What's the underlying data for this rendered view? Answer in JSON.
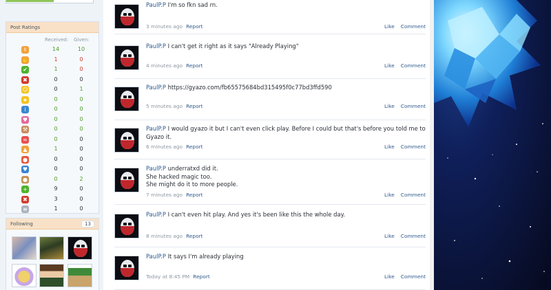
{
  "ratings": {
    "title": "Post Ratings",
    "received_label": "Received:",
    "given_label": "Given:",
    "rows": [
      {
        "icon": "thumbs-up-icon",
        "color": "#f2a13b",
        "glyph": "✌",
        "received": "14",
        "given": "10",
        "rec_tone": "pos",
        "giv_tone": "pos"
      },
      {
        "icon": "thumbs-down-icon",
        "color": "#f2a13b",
        "glyph": "✋",
        "received": "1",
        "given": "0",
        "rec_tone": "neg",
        "giv_tone": "neg"
      },
      {
        "icon": "agree-icon",
        "color": "#4fb32d",
        "glyph": "✔",
        "received": "1",
        "given": "0",
        "rec_tone": "pos",
        "giv_tone": "neg"
      },
      {
        "icon": "disagree-icon",
        "color": "#d33a2d",
        "glyph": "✖",
        "received": "0",
        "given": "0",
        "rec_tone": "",
        "giv_tone": ""
      },
      {
        "icon": "funny-icon",
        "color": "#f5c21b",
        "glyph": "☺",
        "received": "0",
        "given": "1",
        "rec_tone": "",
        "giv_tone": "pos"
      },
      {
        "icon": "winner-icon",
        "color": "#f5c21b",
        "glyph": "★",
        "received": "0",
        "given": "0",
        "rec_tone": "pos",
        "giv_tone": "pos"
      },
      {
        "icon": "informative-icon",
        "color": "#3a86d1",
        "glyph": "i",
        "received": "0",
        "given": "0",
        "rec_tone": "pos",
        "giv_tone": "pos"
      },
      {
        "icon": "friendly-icon",
        "color": "#e36b9b",
        "glyph": "♥",
        "received": "0",
        "given": "0",
        "rec_tone": "pos",
        "giv_tone": "pos"
      },
      {
        "icon": "useful-icon",
        "color": "#c98b5e",
        "glyph": "⚒",
        "received": "0",
        "given": "0",
        "rec_tone": "pos",
        "giv_tone": "pos"
      },
      {
        "icon": "creative-icon",
        "color": "#e94f4f",
        "glyph": "≈",
        "received": "0",
        "given": "0",
        "rec_tone": "pos",
        "giv_tone": ""
      },
      {
        "icon": "optimistic-icon",
        "color": "#f2a13b",
        "glyph": "▲",
        "received": "1",
        "given": "0",
        "rec_tone": "pos",
        "giv_tone": ""
      },
      {
        "icon": "late-icon",
        "color": "#e9563f",
        "glyph": "●",
        "received": "0",
        "given": "0",
        "rec_tone": "",
        "giv_tone": ""
      },
      {
        "icon": "artistic-icon",
        "color": "#3a86d1",
        "glyph": "♥",
        "received": "0",
        "given": "0",
        "rec_tone": "",
        "giv_tone": ""
      },
      {
        "icon": "cookie-icon",
        "color": "#c79155",
        "glyph": "●",
        "received": "0",
        "given": "2",
        "rec_tone": "pos",
        "giv_tone": "pos"
      },
      {
        "icon": "plus-icon",
        "color": "#4fb32d",
        "glyph": "+",
        "received": "9",
        "given": "0",
        "rec_tone": "",
        "giv_tone": ""
      },
      {
        "icon": "minus-icon",
        "color": "#d33a2d",
        "glyph": "✖",
        "received": "3",
        "given": "0",
        "rec_tone": "",
        "giv_tone": ""
      },
      {
        "icon": "list-icon",
        "color": "#aab4bf",
        "glyph": "≡",
        "received": "1",
        "given": "0",
        "rec_tone": "",
        "giv_tone": ""
      }
    ]
  },
  "following": {
    "title": "Following",
    "count": "13"
  },
  "posts": [
    {
      "author": "PaulP.P",
      "text": "I'm so fkn sad rn.",
      "time": "3 minutes ago",
      "report": "Report",
      "like": "Like",
      "comment": "Comment"
    },
    {
      "author": "PaulP.P",
      "text": "I can't get it right as it says \"Already Playing\"",
      "time": "4 minutes ago",
      "report": "Report",
      "like": "Like",
      "comment": "Comment"
    },
    {
      "author": "PaulP.P",
      "text": "https://gyazo.com/fb65575684bd315495f0c77bd3ffd590",
      "time": "5 minutes ago",
      "report": "Report",
      "like": "Like",
      "comment": "Comment"
    },
    {
      "author": "PaulP.P",
      "text": "I would gyazo it but I can't even click play. Before I could but that's before you told me to Gyazo it.",
      "time": "6 minutes ago",
      "report": "Report",
      "like": "Like",
      "comment": "Comment"
    },
    {
      "author": "PaulP.P",
      "text": "underratxd did it.\nShe hacked magic too.\nShe might do it to more people.",
      "time": "7 minutes ago",
      "report": "Report",
      "like": "Like",
      "comment": "Comment"
    },
    {
      "author": "PaulP.P",
      "text": "I can't even hit play. And yes it's been like this the whole day.",
      "time": "8 minutes ago",
      "report": "Report",
      "like": "Like",
      "comment": "Comment"
    },
    {
      "author": "PaulP.P",
      "text": "It says I'm already playing",
      "time": "Today at 8:45 PM",
      "report": "Report",
      "like": "Like",
      "comment": "Comment"
    }
  ],
  "colors": {
    "link": "#2f5a8e",
    "panel_header": "#f9e1c7",
    "sidebar_bg": "#eef3f8",
    "space_bg": "#0a1233"
  },
  "progress": {
    "fraction": 0.55
  }
}
